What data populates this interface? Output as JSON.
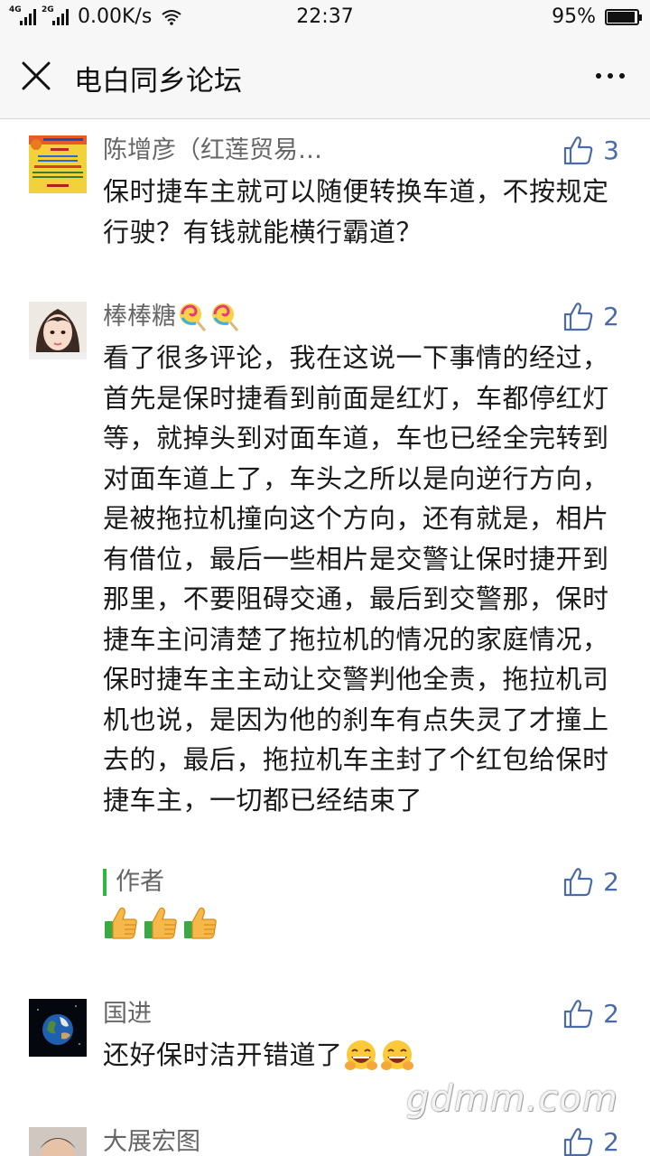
{
  "status_bar": {
    "net_1": "4G",
    "net_2": "2G",
    "speed": "0.00K/s",
    "time": "22:37",
    "battery": "95%",
    "battery_level": 0.95
  },
  "nav": {
    "title": "电白同乡论坛"
  },
  "comments": [
    {
      "name": "陈增彦（红莲贸易…",
      "likes": "3",
      "text": "保时捷车主就可以随便转换车道，不按规定行驶？有钱就能横行霸道？"
    },
    {
      "name": "棒棒糖",
      "likes": "2",
      "text": "看了很多评论，我在这说一下事情的经过，首先是保时捷看到前面是红灯，车都停红灯等，就掉头到对面车道，车也已经全完转到对面车道上了，车头之所以是向逆行方向，是被拖拉机撞向这个方向，还有就是，相片有借位，最后一些相片是交警让保时捷开到那里，不要阻碍交通，最后到交警那，保时捷车主问清楚了拖拉机的情况的家庭情况，保时捷车主主动让交警判他全责，拖拉机司机也说，是因为他的刹车有点失灵了才撞上去的，最后，拖拉机车主封了个红包给保时捷车主，一切都已经结束了",
      "reply": {
        "name": "作者",
        "likes": "2"
      }
    },
    {
      "name": "国进",
      "likes": "2",
      "text": "还好保时洁开错道了"
    },
    {
      "name": "大展宏图",
      "likes": "2"
    }
  ],
  "watermark": "gdmm.com",
  "icons": {
    "close": "close-icon",
    "more": "more-icon",
    "like": "thumbs-up-outline-icon",
    "lollipop": "lollipop-emoji",
    "thumbs": "thumbs-up-emoji",
    "grin": "grinning-emoji"
  },
  "colors": {
    "like": "#4a6aa8",
    "reply_bar": "#2db640",
    "name": "#666666"
  }
}
